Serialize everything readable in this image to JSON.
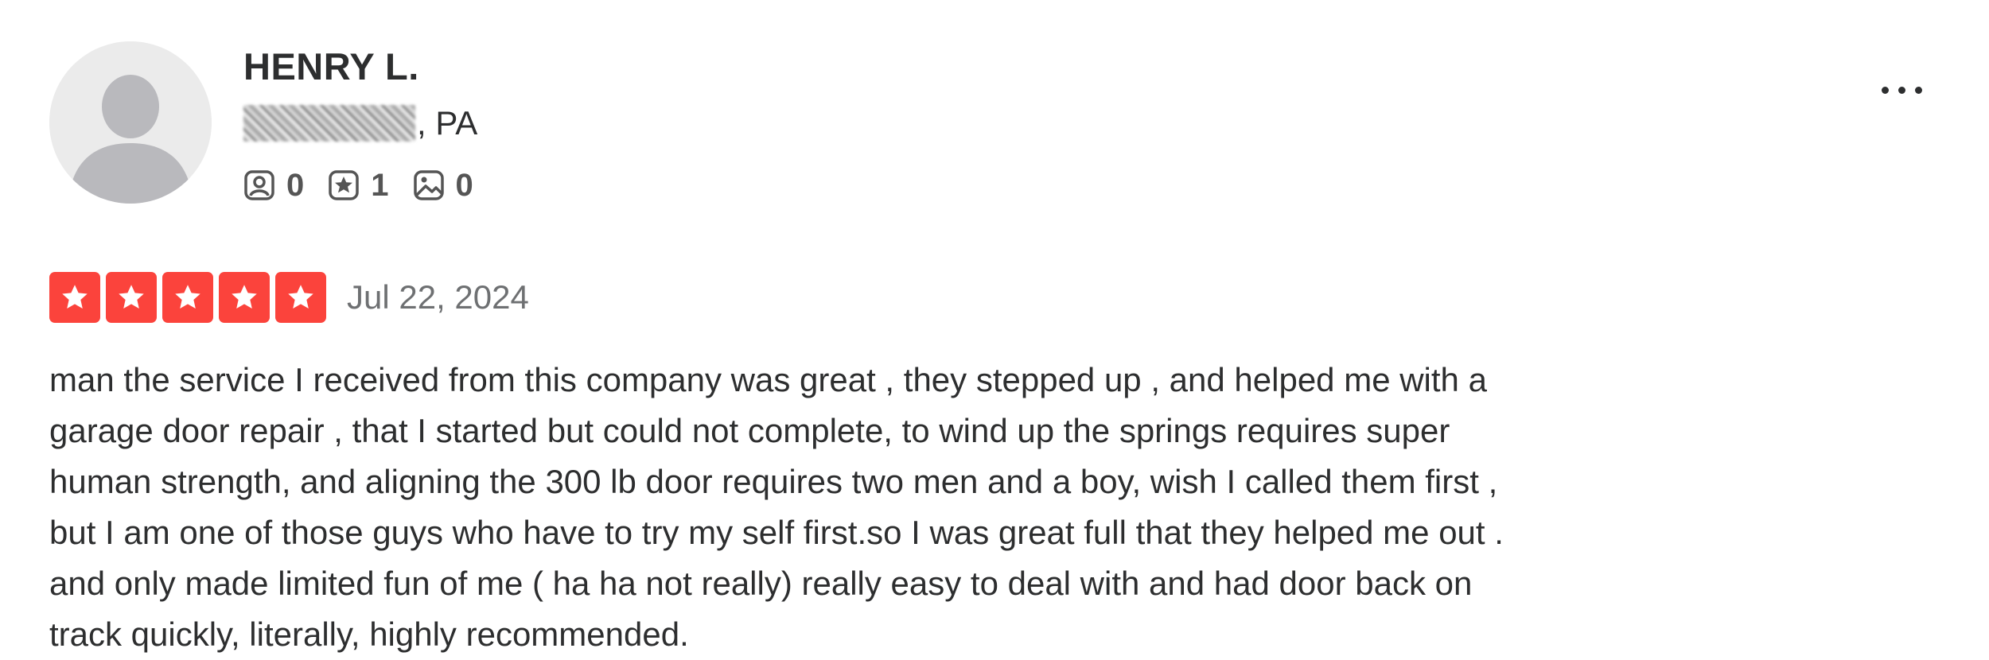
{
  "reviewer": {
    "name": "HENRY L.",
    "location_redacted": true,
    "location_suffix": ", PA",
    "avatar_icon": "default-user-avatar-icon",
    "stats": {
      "friends": {
        "icon": "friends-icon",
        "count": "0"
      },
      "reviews": {
        "icon": "reviews-icon",
        "count": "1"
      },
      "photos": {
        "icon": "photos-icon",
        "count": "0"
      }
    }
  },
  "menu": {
    "icon": "more-options-icon"
  },
  "review": {
    "rating": 5,
    "max_rating": 5,
    "star_color": "#fb433c",
    "date": "Jul 22, 2024",
    "text_lines": [
      "man the service I received from this company was great , they stepped up , and helped me with a",
      "garage door repair , that I started but could not complete, to wind up the springs requires super",
      "human strength, and aligning the 300 lb door requires two men and a boy, wish I called them first ,",
      "but I am one of those guys who have to try my self first.so I was great full that they helped me out .",
      "and only made limited fun of me ( ha ha not really) really easy to deal with and had door back on",
      "track quickly, literally, highly recommended."
    ]
  }
}
